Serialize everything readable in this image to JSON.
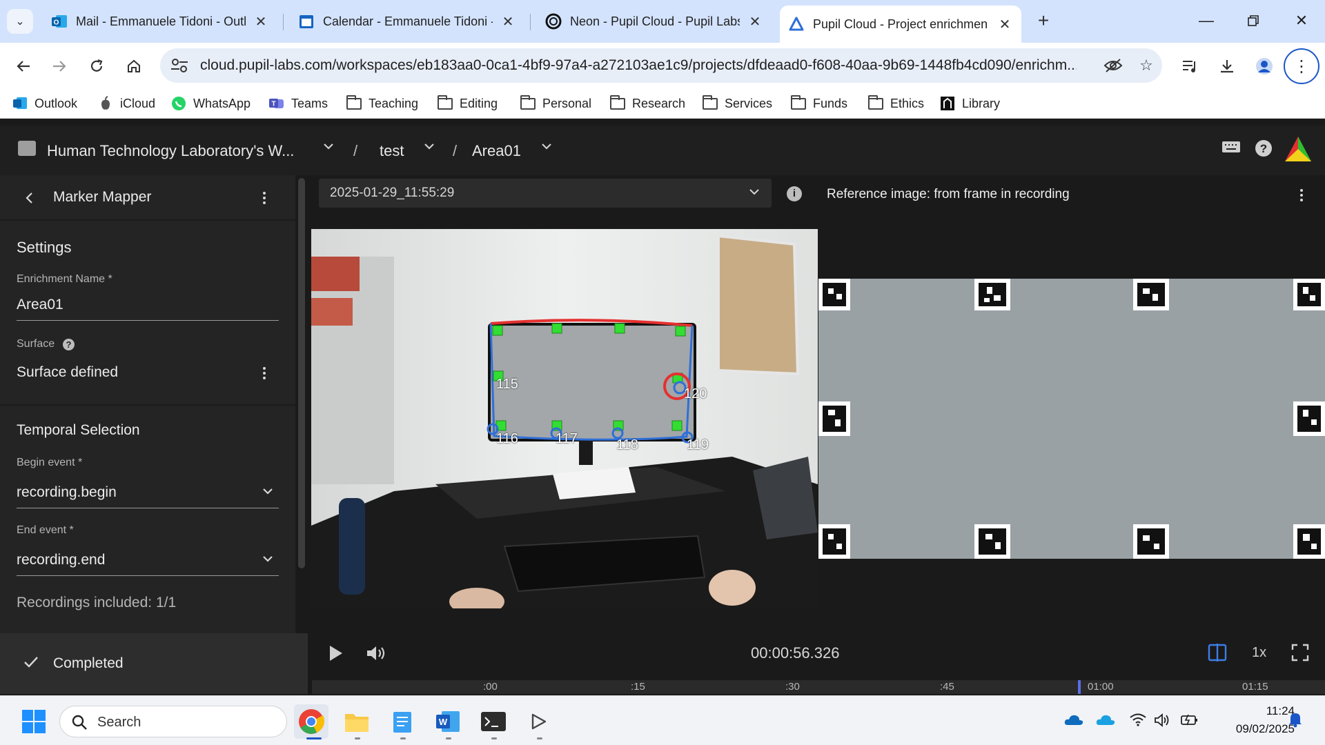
{
  "browser": {
    "tabs": [
      {
        "label": "Mail - Emmanuele Tidoni - Outl",
        "active": false
      },
      {
        "label": "Calendar - Emmanuele Tidoni -",
        "active": false
      },
      {
        "label": "Neon - Pupil Cloud - Pupil Labs",
        "active": false
      },
      {
        "label": "Pupil Cloud - Project enrichmen",
        "active": true
      }
    ],
    "url": "cloud.pupil-labs.com/workspaces/eb183aa0-0ca1-4bf9-97a4-a272103ae1c9/projects/dfdeaad0-f608-40aa-9b69-1448fb4cd090/enrichm...",
    "bookmarks": [
      "Outlook",
      "iCloud",
      "WhatsApp",
      "Teams",
      "Teaching",
      "Editing",
      "Personal",
      "Research",
      "Services",
      "Funds",
      "Ethics",
      "Library"
    ]
  },
  "app": {
    "breadcrumb": {
      "workspace": "Human Technology Laboratory's W...",
      "separator": "/",
      "project": "test",
      "enrichment": "Area01"
    },
    "sidebar": {
      "title": "Marker Mapper",
      "settings_heading": "Settings",
      "enrichment_name_label": "Enrichment Name *",
      "enrichment_name_value": "Area01",
      "surface_label": "Surface",
      "surface_value": "Surface defined",
      "temporal_heading": "Temporal Selection",
      "begin_event_label": "Begin event *",
      "begin_event_value": "recording.begin",
      "end_event_label": "End event *",
      "end_event_value": "recording.end",
      "recordings_included": "Recordings included: 1/1",
      "status": "Completed"
    },
    "player": {
      "recording": "2025-01-29_11:55:29",
      "reference_title": "Reference image: from frame in recording",
      "marker_ids": [
        "115",
        "120",
        "116",
        "117",
        "118",
        "119"
      ],
      "timestamp": "00:00:56.326",
      "speed": "1x",
      "timeline_labels": [
        ":00",
        ":15",
        ":30",
        ":45",
        "01:00",
        "01:15"
      ],
      "playhead_fraction": 0.756
    }
  },
  "taskbar": {
    "search_placeholder": "Search",
    "time": "11:24",
    "date": "09/02/2025"
  },
  "colors": {
    "surface_outline": "#2f6fd8",
    "surface_top_edge": "#e53030",
    "marker_detected": "#33dd33",
    "accent": "#3d7ee8"
  }
}
